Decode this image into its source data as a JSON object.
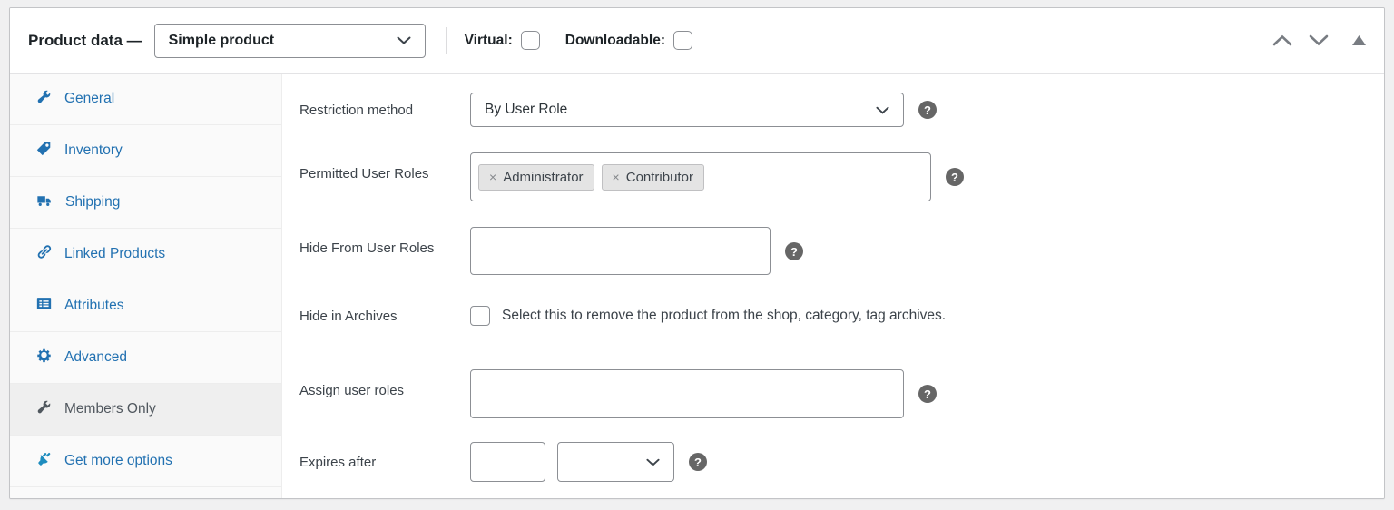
{
  "header": {
    "title": "Product data —",
    "product_type": "Simple product",
    "virtual_label": "Virtual:",
    "downloadable_label": "Downloadable:"
  },
  "sidebar": {
    "items": [
      {
        "label": "General",
        "icon": "wrench-icon"
      },
      {
        "label": "Inventory",
        "icon": "tag-icon"
      },
      {
        "label": "Shipping",
        "icon": "truck-icon"
      },
      {
        "label": "Linked Products",
        "icon": "link-icon"
      },
      {
        "label": "Attributes",
        "icon": "list-icon"
      },
      {
        "label": "Advanced",
        "icon": "gear-icon"
      },
      {
        "label": "Members Only",
        "icon": "wrench-icon",
        "active": true
      },
      {
        "label": "Get more options",
        "icon": "plug-icon"
      }
    ]
  },
  "form": {
    "restriction_method": {
      "label": "Restriction method",
      "value": "By User Role"
    },
    "permitted_user_roles": {
      "label": "Permitted User Roles",
      "tags": [
        "Administrator",
        "Contributor"
      ],
      "remove_glyph": "×"
    },
    "hide_from_user_roles": {
      "label": "Hide From User Roles",
      "value": ""
    },
    "hide_in_archives": {
      "label": "Hide in Archives",
      "checkbox_text": "Select this to remove the product from the shop, category, tag archives.",
      "checked": false
    },
    "assign_user_roles": {
      "label": "Assign user roles",
      "value": ""
    },
    "expires_after": {
      "label": "Expires after",
      "number_value": "",
      "unit_value": ""
    }
  },
  "help_glyph": "?",
  "colors": {
    "link_blue": "#2271b1",
    "label_text": "#3c434a",
    "active_tab_bg": "#efefef",
    "panel_border": "#c3c4c7",
    "input_border": "#8c8f94",
    "help_bg": "#666666",
    "tag_bg": "#e4e4e4"
  }
}
